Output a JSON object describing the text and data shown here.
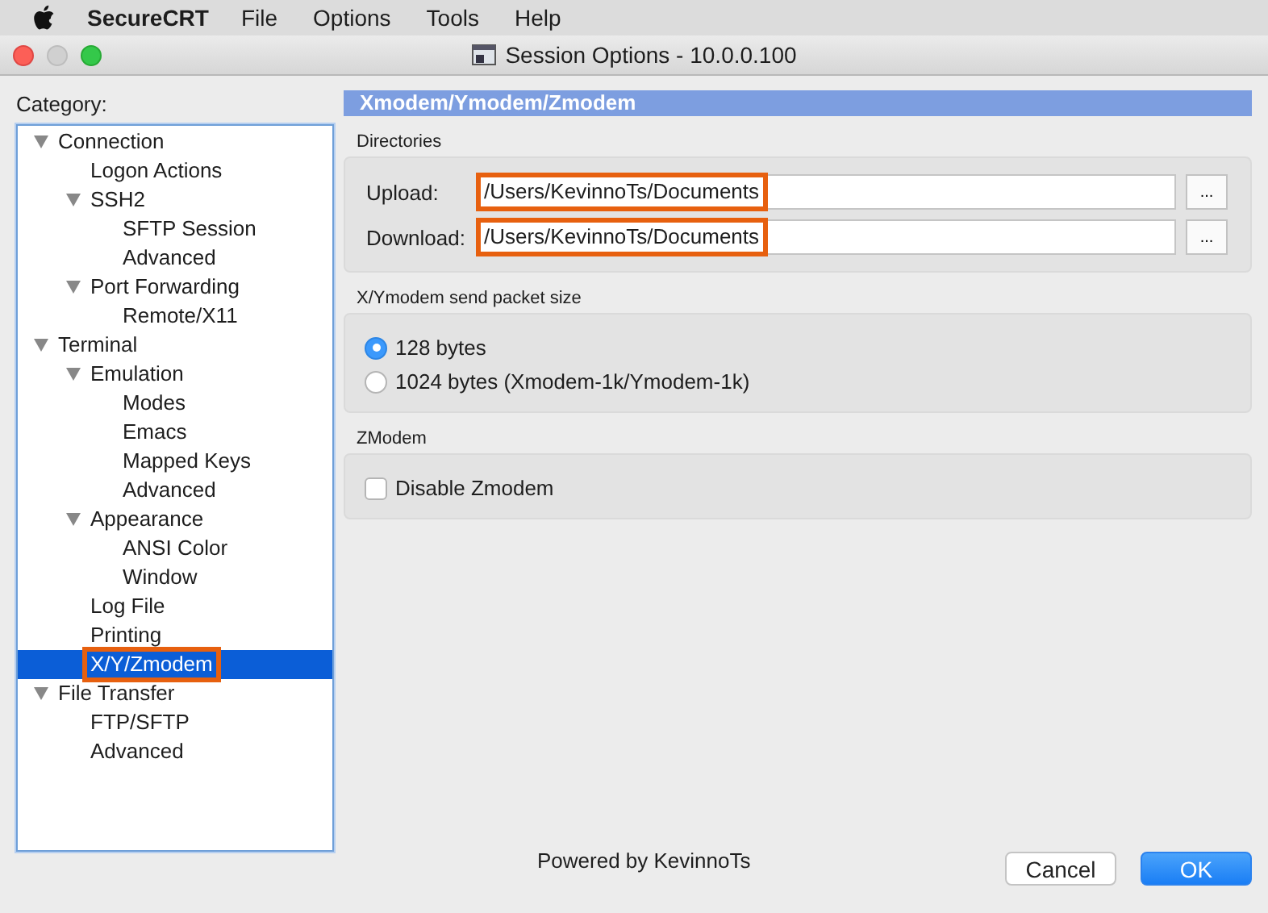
{
  "menu_bar": {
    "app": "SecureCRT",
    "items": [
      "File",
      "Options",
      "Tools",
      "Help"
    ]
  },
  "window": {
    "title": "Session Options - 10.0.0.100"
  },
  "category": {
    "label": "Category:",
    "tree": [
      {
        "label": "Connection",
        "expanded": true,
        "selected": false,
        "highlighted": false,
        "children": [
          {
            "label": "Logon Actions",
            "selected": false,
            "highlighted": false
          },
          {
            "label": "SSH2",
            "expanded": true,
            "selected": false,
            "highlighted": false,
            "children": [
              {
                "label": "SFTP Session",
                "selected": false,
                "highlighted": false
              },
              {
                "label": "Advanced",
                "selected": false,
                "highlighted": false
              }
            ]
          },
          {
            "label": "Port Forwarding",
            "expanded": true,
            "selected": false,
            "highlighted": false,
            "children": [
              {
                "label": "Remote/X11",
                "selected": false,
                "highlighted": false
              }
            ]
          }
        ]
      },
      {
        "label": "Terminal",
        "expanded": true,
        "selected": false,
        "highlighted": false,
        "children": [
          {
            "label": "Emulation",
            "expanded": true,
            "selected": false,
            "highlighted": false,
            "children": [
              {
                "label": "Modes",
                "selected": false,
                "highlighted": false
              },
              {
                "label": "Emacs",
                "selected": false,
                "highlighted": false
              },
              {
                "label": "Mapped Keys",
                "selected": false,
                "highlighted": false
              },
              {
                "label": "Advanced",
                "selected": false,
                "highlighted": false
              }
            ]
          },
          {
            "label": "Appearance",
            "expanded": true,
            "selected": false,
            "highlighted": false,
            "children": [
              {
                "label": "ANSI Color",
                "selected": false,
                "highlighted": false
              },
              {
                "label": "Window",
                "selected": false,
                "highlighted": false
              }
            ]
          },
          {
            "label": "Log File",
            "selected": false,
            "highlighted": false
          },
          {
            "label": "Printing",
            "selected": false,
            "highlighted": false
          },
          {
            "label": "X/Y/Zmodem",
            "selected": true,
            "highlighted": true
          }
        ]
      },
      {
        "label": "File Transfer",
        "expanded": true,
        "selected": false,
        "highlighted": false,
        "children": [
          {
            "label": "FTP/SFTP",
            "selected": false,
            "highlighted": false
          },
          {
            "label": "Advanced",
            "selected": false,
            "highlighted": false
          }
        ]
      }
    ]
  },
  "panel": {
    "title": "Xmodem/Ymodem/Zmodem",
    "directories": {
      "label": "Directories",
      "fields": [
        {
          "label": "Upload:",
          "value": "/Users/KevinnoTs/Documents",
          "highlighted": true,
          "browse": "..."
        },
        {
          "label": "Download:",
          "value": "/Users/KevinnoTs/Documents",
          "highlighted": true,
          "browse": "..."
        }
      ]
    },
    "packet_size": {
      "label": "X/Ymodem send packet size",
      "options": [
        {
          "label": "128 bytes",
          "selected": true
        },
        {
          "label": "1024 bytes (Xmodem-1k/Ymodem-1k)",
          "selected": false
        }
      ]
    },
    "zmodem": {
      "label": "ZModem",
      "options": [
        {
          "label": "Disable Zmodem",
          "checked": false
        }
      ]
    }
  },
  "footer": {
    "text": "Powered by KevinnoTs",
    "buttons": [
      {
        "label": "Cancel",
        "kind": "secondary"
      },
      {
        "label": "OK",
        "kind": "primary"
      }
    ]
  }
}
